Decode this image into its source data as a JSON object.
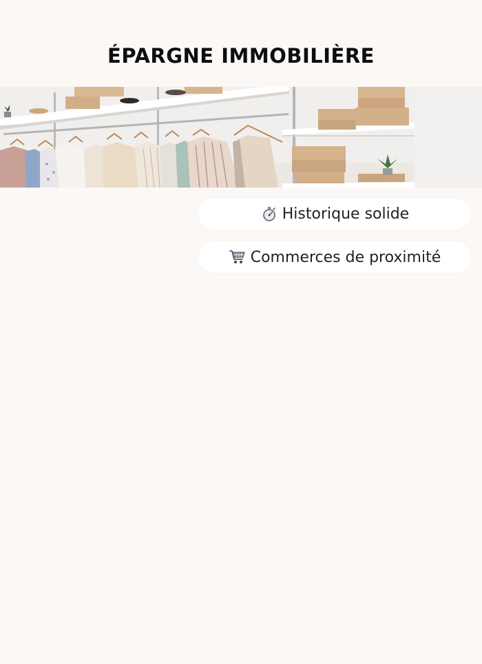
{
  "page": {
    "title": "ÉPARGNE IMMOBILIÈRE"
  },
  "hero_image": {
    "icon": "wardrobe-shelves-photo"
  },
  "features": [
    {
      "label": "Historique solide",
      "icon": "stopwatch-icon"
    },
    {
      "label": "Commerces de proximité",
      "icon": "shopping-cart-icon"
    }
  ],
  "colors": {
    "background": "#fbf8f6",
    "pill": "#ffffff",
    "text": "#1b1b1b"
  }
}
